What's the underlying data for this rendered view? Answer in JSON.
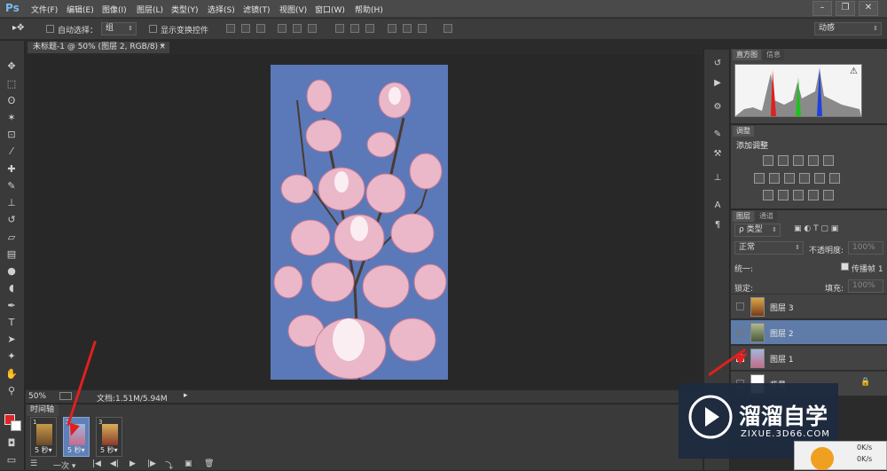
{
  "app": {
    "logo": "Ps"
  },
  "menu": [
    "文件(F)",
    "编辑(E)",
    "图像(I)",
    "图层(L)",
    "类型(Y)",
    "选择(S)",
    "滤镜(T)",
    "视图(V)",
    "窗口(W)",
    "帮助(H)"
  ],
  "options": {
    "auto_select_label": "自动选择：",
    "auto_select_value": "组",
    "show_transform_label": "显示变换控件",
    "workspace": "动感"
  },
  "document": {
    "tab_title": "未标题-1 @ 50% (图层 2, RGB/8) *",
    "zoom": "50%",
    "doc_size": "文档:1.51M/5.94M"
  },
  "timeline": {
    "tab": "时间轴",
    "frames": [
      {
        "num": "1",
        "duration": "5 秒▾"
      },
      {
        "num": "2",
        "duration": "5 秒▾"
      },
      {
        "num": "3",
        "duration": "5 秒▾"
      }
    ],
    "loop": "一次"
  },
  "panels": {
    "histogram_tab": "直方图",
    "info_tab": "信息",
    "adjustments_tab": "调整",
    "add_adjustment": "添加调整",
    "layers_tab": "图层",
    "channels_tab": "通道",
    "kind_filter": "ρ 类型",
    "blend_mode": "正常",
    "opacity_label": "不透明度:",
    "opacity_value": "100%",
    "unify_label": "统一:",
    "propagate_label": "传播帧 1",
    "lock_label": "锁定:",
    "fill_label": "填充:",
    "fill_value": "100%"
  },
  "layers": [
    {
      "name": "图层 3",
      "visible": false,
      "selected": false
    },
    {
      "name": "图层 2",
      "visible": false,
      "selected": true
    },
    {
      "name": "图层 1",
      "visible": true,
      "selected": false
    },
    {
      "name": "背景",
      "visible": false,
      "selected": false
    }
  ],
  "watermark": {
    "title": "溜溜自学",
    "url": "ZIXUE.3D66.COM"
  },
  "taskbar": {
    "speed_up": "0K/s",
    "speed_down": "0K/s"
  }
}
